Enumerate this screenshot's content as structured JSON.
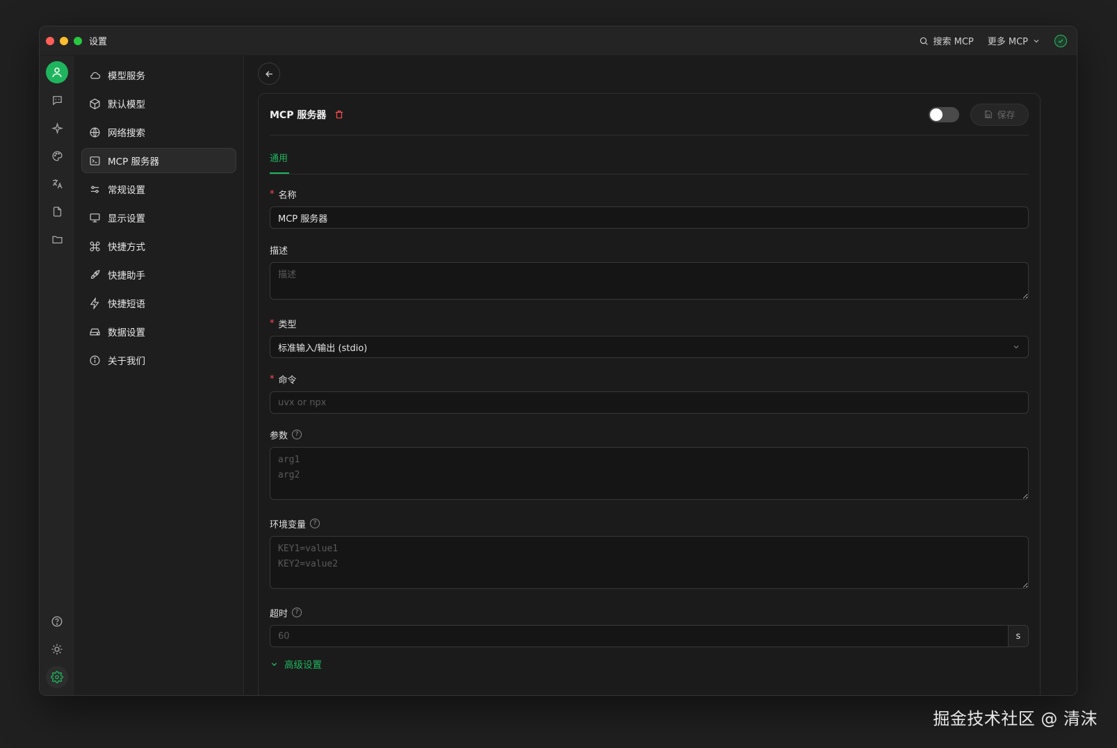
{
  "window": {
    "title": "设置"
  },
  "titlebar": {
    "search_label": "搜索 MCP",
    "more_label": "更多 MCP"
  },
  "sidebar": {
    "items": [
      {
        "label": "模型服务",
        "icon": "cloud-icon"
      },
      {
        "label": "默认模型",
        "icon": "cube-icon"
      },
      {
        "label": "网络搜索",
        "icon": "globe-icon"
      },
      {
        "label": "MCP 服务器",
        "icon": "terminal-icon",
        "active": true
      },
      {
        "label": "常规设置",
        "icon": "sliders-icon"
      },
      {
        "label": "显示设置",
        "icon": "monitor-icon"
      },
      {
        "label": "快捷方式",
        "icon": "command-icon"
      },
      {
        "label": "快捷助手",
        "icon": "rocket-icon"
      },
      {
        "label": "快捷短语",
        "icon": "lightning-icon"
      },
      {
        "label": "数据设置",
        "icon": "drive-icon"
      },
      {
        "label": "关于我们",
        "icon": "info-icon"
      }
    ]
  },
  "card": {
    "title": "MCP 服务器",
    "save_label": "保存",
    "enabled": false,
    "tab_general": "通用",
    "fields": {
      "name": {
        "label": "名称",
        "value": "MCP 服务器"
      },
      "description": {
        "label": "描述",
        "placeholder": "描述"
      },
      "type": {
        "label": "类型",
        "value": "标准输入/输出 (stdio)"
      },
      "command": {
        "label": "命令",
        "placeholder": "uvx or npx"
      },
      "args": {
        "label": "参数",
        "placeholder": "arg1\narg2"
      },
      "env": {
        "label": "环境变量",
        "placeholder": "KEY1=value1\nKEY2=value2"
      },
      "timeout": {
        "label": "超时",
        "placeholder": "60",
        "unit": "s"
      }
    },
    "advanced_label": "高级设置"
  },
  "watermark": "掘金技术社区 @ 清沫",
  "colors": {
    "accent": "#1fb55e",
    "danger": "#ff4d4f",
    "background": "#1b1b1b"
  }
}
